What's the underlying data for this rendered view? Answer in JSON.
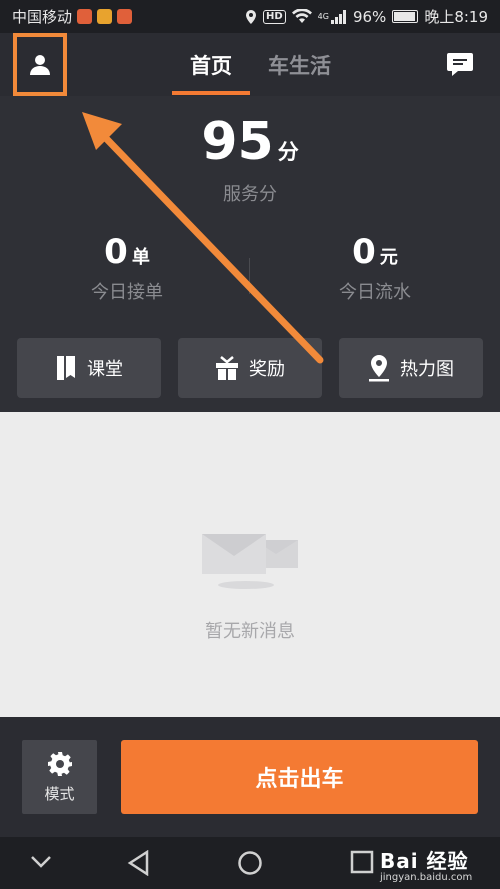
{
  "status_bar": {
    "carrier": "中国移动",
    "network": "4G",
    "hd": "HD",
    "battery": "96%",
    "time": "晚上8:19"
  },
  "header": {
    "tabs": [
      {
        "label": "首页",
        "active": true
      },
      {
        "label": "车生活",
        "active": false
      }
    ]
  },
  "stats": {
    "score_value": "95",
    "score_unit": "分",
    "score_label": "服务分",
    "orders_value": "0",
    "orders_unit": "单",
    "orders_label": "今日接单",
    "income_value": "0",
    "income_unit": "元",
    "income_label": "今日流水"
  },
  "quick_actions": [
    {
      "label": "课堂",
      "icon": "book-icon"
    },
    {
      "label": "奖励",
      "icon": "gift-icon"
    },
    {
      "label": "热力图",
      "icon": "location-pin-icon"
    }
  ],
  "messages": {
    "empty_text": "暂无新消息"
  },
  "bottom": {
    "mode_label": "模式",
    "go_label": "点击出车"
  },
  "watermark": {
    "brand": "Bai 经验",
    "url": "jingyan.baidu.com"
  },
  "colors": {
    "accent": "#f47a33",
    "highlight": "#f28a3a",
    "dark_bg": "#2b2c32",
    "content_bg": "#ececec"
  }
}
